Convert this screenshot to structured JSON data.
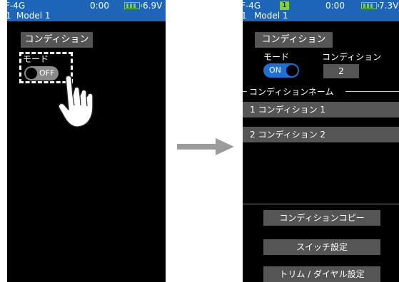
{
  "left_screen": {
    "status": {
      "system": "F-4G",
      "timer": "0:00",
      "voltage": "6.9V"
    },
    "model": {
      "number": "1",
      "name": "Model 1"
    },
    "header_tab": "コンディション",
    "mode_label": "モード",
    "toggle_label": "OFF"
  },
  "right_screen": {
    "status": {
      "system": "F-4G",
      "condition_badge": "1",
      "timer": "0:00",
      "voltage": "7.3V"
    },
    "model": {
      "number": "1",
      "name": "Model 1"
    },
    "header_tab": "コンディション",
    "mode_label": "モード",
    "condition_label": "コンディション",
    "toggle_label": "ON",
    "condition_value": "2",
    "section_title": "コンディションネーム",
    "conditions": [
      {
        "label": "1 コンディション 1"
      },
      {
        "label": "2 コンディション 2"
      }
    ],
    "buttons": [
      {
        "label": "コンディションコピー"
      },
      {
        "label": "スイッチ設定"
      },
      {
        "label": "トリム / ダイヤル設定"
      }
    ]
  },
  "colors": {
    "status_bar": "#1e64b8",
    "battery": "#7fd13b",
    "toggle_on": "#1e6fd6",
    "button_bg": "#555555"
  },
  "icons": [
    "battery-icon",
    "hand-pointer-icon",
    "arrow-right-icon"
  ]
}
